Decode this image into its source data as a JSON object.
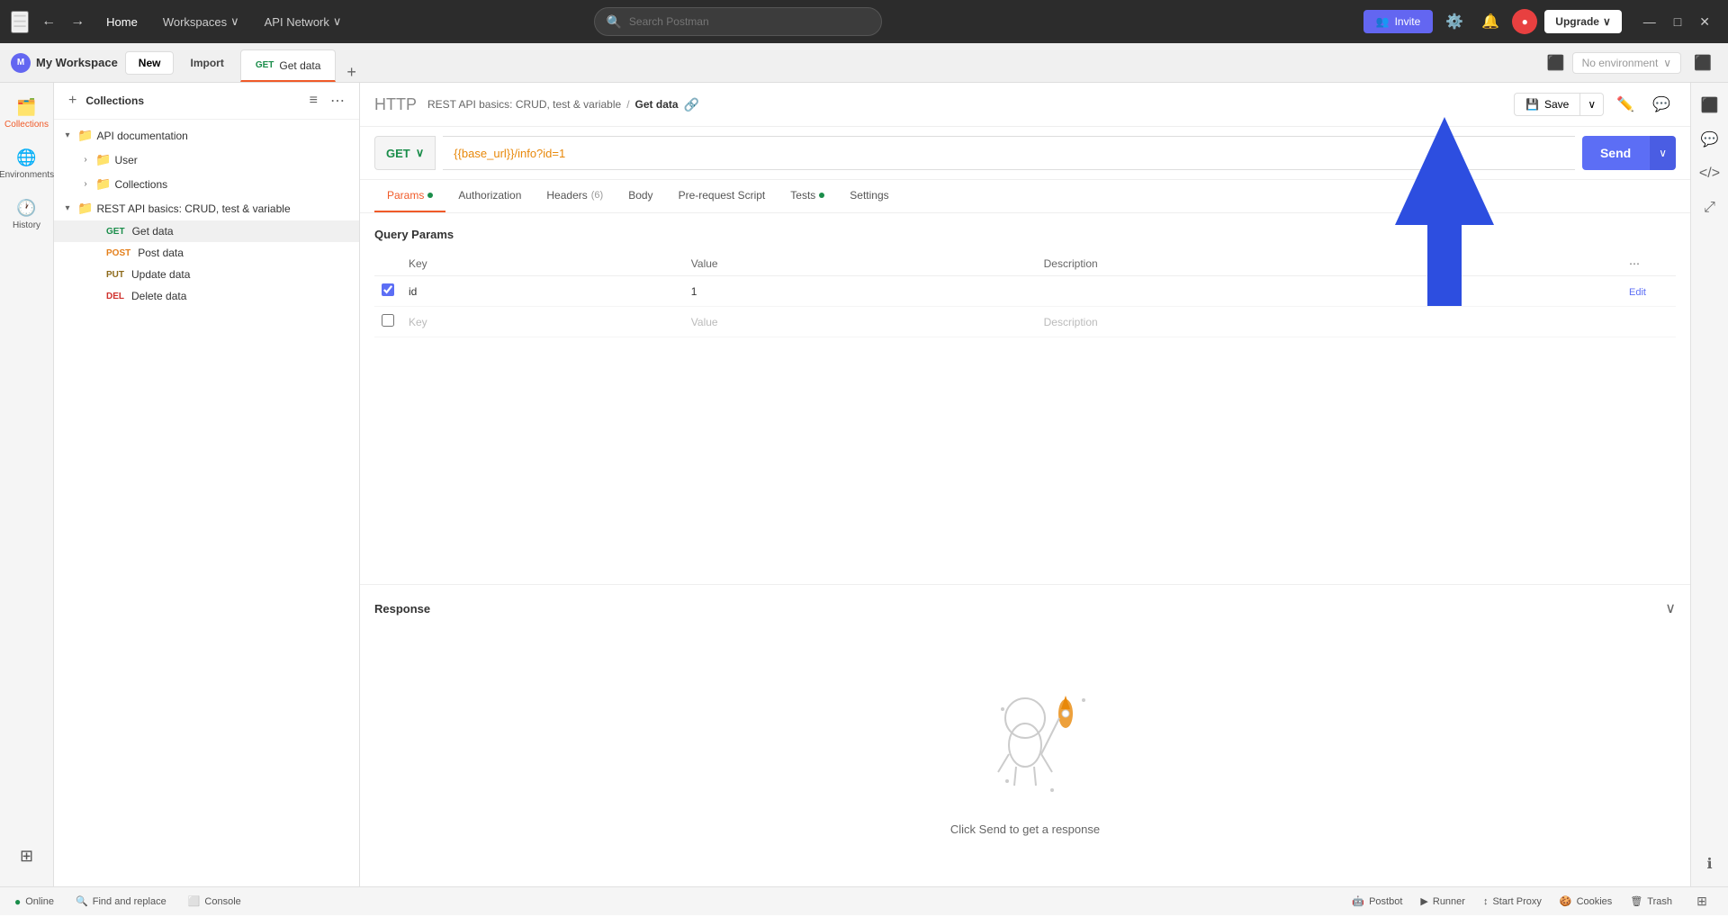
{
  "titlebar": {
    "menu_label": "☰",
    "back_label": "←",
    "forward_label": "→",
    "home_label": "Home",
    "workspaces_label": "Workspaces",
    "workspaces_arrow": "∨",
    "apinetwork_label": "API Network",
    "apinetwork_arrow": "∨",
    "search_placeholder": "Search Postman",
    "invite_label": "Invite",
    "upgrade_label": "Upgrade",
    "upgrade_arrow": "∨",
    "minimize": "—",
    "maximize": "□",
    "close": "✕"
  },
  "workspacebar": {
    "workspace_name": "My Workspace",
    "new_label": "New",
    "import_label": "Import",
    "tab_method": "GET",
    "tab_name": "Get data",
    "tab_add": "+",
    "env_label": "No environment",
    "env_arrow": "∨"
  },
  "sidebar": {
    "collections_label": "Collections",
    "history_label": "History",
    "environments_label": "Environments",
    "apps_label": ""
  },
  "collections_panel": {
    "title": "Collections",
    "add_btn": "+",
    "filter_btn": "≡",
    "more_btn": "⋯",
    "items": [
      {
        "id": "api-docs",
        "label": "API documentation",
        "type": "folder",
        "level": 0,
        "expanded": true
      },
      {
        "id": "user",
        "label": "User",
        "type": "folder",
        "level": 1,
        "expanded": false
      },
      {
        "id": "collections",
        "label": "Collections",
        "type": "folder",
        "level": 1,
        "expanded": false
      },
      {
        "id": "rest-api",
        "label": "REST API basics: CRUD, test & variable",
        "type": "folder",
        "level": 0,
        "expanded": true
      },
      {
        "id": "get-data",
        "label": "Get data",
        "type": "request",
        "method": "GET",
        "level": 2,
        "active": true
      },
      {
        "id": "post-data",
        "label": "Post data",
        "type": "request",
        "method": "POST",
        "level": 2
      },
      {
        "id": "update-data",
        "label": "Update data",
        "type": "request",
        "method": "PUT",
        "level": 2
      },
      {
        "id": "delete-data",
        "label": "Delete data",
        "type": "request",
        "method": "DEL",
        "level": 2
      }
    ]
  },
  "request": {
    "breadcrumb_collection": "REST API basics: CRUD, test & variable",
    "breadcrumb_sep": "/",
    "breadcrumb_current": "Get data",
    "save_label": "Save",
    "method": "GET",
    "url": "{{base_url}}/info?id=1",
    "url_prefix": "",
    "send_label": "Send"
  },
  "request_tabs": [
    {
      "id": "params",
      "label": "Params",
      "active": true,
      "dot": true,
      "dot_color": "green"
    },
    {
      "id": "authorization",
      "label": "Authorization",
      "active": false
    },
    {
      "id": "headers",
      "label": "Headers",
      "count": "6",
      "active": false
    },
    {
      "id": "body",
      "label": "Body",
      "active": false
    },
    {
      "id": "pre-request",
      "label": "Pre-request Script",
      "active": false
    },
    {
      "id": "tests",
      "label": "Tests",
      "active": false,
      "dot": true,
      "dot_color": "green"
    },
    {
      "id": "settings",
      "label": "Settings",
      "active": false
    }
  ],
  "query_params": {
    "title": "Query Params",
    "columns": [
      "Key",
      "Value",
      "Description"
    ],
    "rows": [
      {
        "checked": true,
        "key": "id",
        "value": "1",
        "description": ""
      }
    ],
    "empty_row": {
      "key": "Key",
      "value": "Value",
      "description": "Description"
    }
  },
  "response": {
    "title": "Response",
    "empty_text": "Click Send to get a response"
  },
  "bottombar": {
    "online_label": "Online",
    "find_replace_label": "Find and replace",
    "console_label": "Console",
    "postbot_label": "Postbot",
    "runner_label": "Runner",
    "start_proxy_label": "Start Proxy",
    "cookies_label": "Cookies",
    "trash_label": "Trash"
  }
}
